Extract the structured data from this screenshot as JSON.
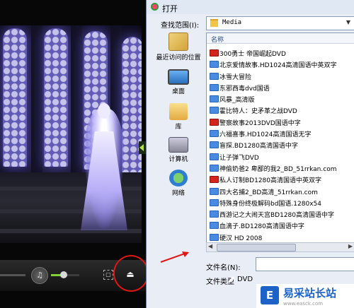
{
  "dialog": {
    "title": "打开",
    "look_in_label": "查找范围(I):",
    "look_in_value": "Media",
    "column_header": "名称",
    "places": [
      {
        "label": "最近访问的位置",
        "icon": "recent-places-icon"
      },
      {
        "label": "桌面",
        "icon": "desktop-icon"
      },
      {
        "label": "库",
        "icon": "library-icon"
      },
      {
        "label": "计算机",
        "icon": "computer-icon"
      },
      {
        "label": "网络",
        "icon": "network-icon"
      }
    ],
    "files": [
      {
        "name": "300勇士 帝国崛起DVD",
        "icon": "video-file-icon",
        "color": "#d3241e"
      },
      {
        "name": "北京爱情故事.HD1024高清国语中英双字",
        "icon": "video-file-icon",
        "color": "#4a8ae0"
      },
      {
        "name": "冰雪大冒险",
        "icon": "video-file-icon",
        "color": "#4a8ae0"
      },
      {
        "name": "东邪西毒dvd国语",
        "icon": "video-file-icon",
        "color": "#4a8ae0"
      },
      {
        "name": "风暴_高清版",
        "icon": "video-file-icon",
        "color": "#4a8ae0"
      },
      {
        "name": "霍比特人：史矛革之战DVD",
        "icon": "video-file-icon",
        "color": "#4a8ae0"
      },
      {
        "name": "警察故事2013DVD国语中字",
        "icon": "video-file-icon",
        "color": "#d3241e"
      },
      {
        "name": "六福喜事.HD1024高清国语无字",
        "icon": "video-file-icon",
        "color": "#4a8ae0"
      },
      {
        "name": "盲探.BD1280高清国语中字",
        "icon": "video-file-icon",
        "color": "#4a8ae0"
      },
      {
        "name": "让子弹飞DVD",
        "icon": "video-file-icon",
        "color": "#4a8ae0"
      },
      {
        "name": "神偷奶爸2 卑鄙的我2_BD_51rrkan.com",
        "icon": "video-file-icon",
        "color": "#4a8ae0"
      },
      {
        "name": "私人订制BD1280高清国语中英双字",
        "icon": "video-file-icon",
        "color": "#d3241e"
      },
      {
        "name": "四大名捕2_BD高清_51rrkan.com",
        "icon": "video-file-icon",
        "color": "#4a8ae0"
      },
      {
        "name": "特殊身份终极解码bd国语.1280x54",
        "icon": "video-file-icon",
        "color": "#4a8ae0"
      },
      {
        "name": "西游记之大闹天宫BD1280高清国语中字",
        "icon": "video-file-icon",
        "color": "#4a8ae0"
      },
      {
        "name": "血滴子.BD1280高清国语中字",
        "icon": "video-file-icon",
        "color": "#4a8ae0"
      },
      {
        "name": "硬汉 HD 2008",
        "icon": "video-file-icon",
        "color": "#4a8ae0"
      }
    ],
    "filename_label": "文件名(N):",
    "filename_value": "",
    "filetype_label": "文件类型",
    "filetype_value": "DVD"
  },
  "player": {
    "volume_level": 0.45,
    "volume_icon": "speaker-icon",
    "fullscreen_icon": "fullscreen-icon",
    "eject_icon": "eject-icon",
    "accent": "#7fd13a"
  },
  "annotations": {
    "highlight_color": "#e01616"
  },
  "watermark": {
    "badge": "E",
    "text": "易采站长站",
    "url": "www.easck.com"
  }
}
